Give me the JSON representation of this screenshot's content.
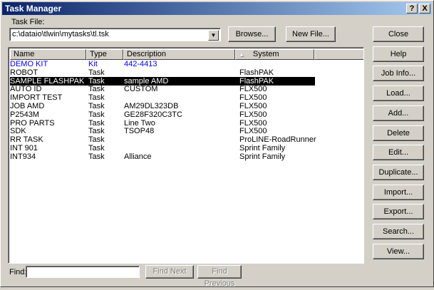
{
  "window": {
    "title": "Task Manager",
    "help_btn": "?",
    "close_btn": "X"
  },
  "task_file": {
    "label": "Task File:",
    "value": "c:\\dataio\\tlwin\\mytasks\\tl.tsk",
    "browse": "Browse...",
    "new_file": "New File..."
  },
  "columns": [
    "Name",
    "Type",
    "Description",
    "System"
  ],
  "sort_indicator": "▲",
  "rows": [
    {
      "name": "DEMO KIT",
      "type": "Kit",
      "description": "442-4413",
      "system": "",
      "kind": "kit"
    },
    {
      "name": "ROBOT",
      "type": "Task",
      "description": "",
      "system": "FlashPAK"
    },
    {
      "name": "SAMPLE FLASHPAK",
      "type": "Task",
      "description": "sample AMD",
      "system": "FlashPAK",
      "selected": true
    },
    {
      "name": "AUTO ID",
      "type": "Task",
      "description": "CUSTOM",
      "system": "FLX500"
    },
    {
      "name": "IMPORT TEST",
      "type": "Task",
      "description": "",
      "system": "FLX500"
    },
    {
      "name": "JOB AMD",
      "type": "Task",
      "description": "AM29DL323DB",
      "system": "FLX500"
    },
    {
      "name": "P2543M",
      "type": "Task",
      "description": "GE28F320C3TC",
      "system": "FLX500"
    },
    {
      "name": "PRO PARTS",
      "type": "Task",
      "description": "Line Two",
      "system": "FLX500"
    },
    {
      "name": "SDK",
      "type": "Task",
      "description": "TSOP48",
      "system": "FLX500"
    },
    {
      "name": "RR TASK",
      "type": "Task",
      "description": "",
      "system": "ProLINE-RoadRunner"
    },
    {
      "name": "INT 901",
      "type": "Task",
      "description": "",
      "system": "Sprint Family"
    },
    {
      "name": "INT934",
      "type": "Task",
      "description": "Alliance",
      "system": "Sprint Family"
    }
  ],
  "side_buttons": [
    "Close",
    "Help",
    "Job Info...",
    "Load...",
    "Add...",
    "Delete",
    "Edit...",
    "Duplicate...",
    "Import...",
    "Export...",
    "Search...",
    "View..."
  ],
  "find": {
    "label": "Find:",
    "value": "",
    "find_next": "Find Next",
    "find_previous": "Find Previous"
  },
  "colors": {
    "kit": "#0000ff",
    "title_start": "#0a246a",
    "title_end": "#a6caf0"
  }
}
